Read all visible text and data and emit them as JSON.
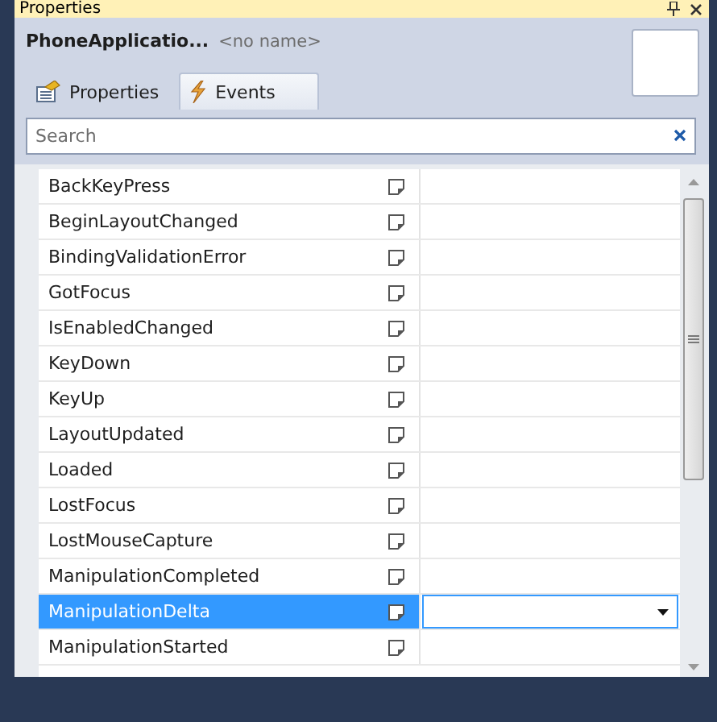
{
  "panel": {
    "title": "Properties"
  },
  "header": {
    "type_name": "PhoneApplicatio...",
    "element_name": "<no name>"
  },
  "tabs": [
    {
      "label": "Properties",
      "selected": false
    },
    {
      "label": "Events",
      "selected": true
    }
  ],
  "search": {
    "placeholder": "Search"
  },
  "events": [
    {
      "name": "BackKeyPress",
      "selected": false
    },
    {
      "name": "BeginLayoutChanged",
      "selected": false
    },
    {
      "name": "BindingValidationError",
      "selected": false
    },
    {
      "name": "GotFocus",
      "selected": false
    },
    {
      "name": "IsEnabledChanged",
      "selected": false
    },
    {
      "name": "KeyDown",
      "selected": false
    },
    {
      "name": "KeyUp",
      "selected": false
    },
    {
      "name": "LayoutUpdated",
      "selected": false
    },
    {
      "name": "Loaded",
      "selected": false
    },
    {
      "name": "LostFocus",
      "selected": false
    },
    {
      "name": "LostMouseCapture",
      "selected": false
    },
    {
      "name": "ManipulationCompleted",
      "selected": false
    },
    {
      "name": "ManipulationDelta",
      "selected": true
    },
    {
      "name": "ManipulationStarted",
      "selected": false
    }
  ]
}
